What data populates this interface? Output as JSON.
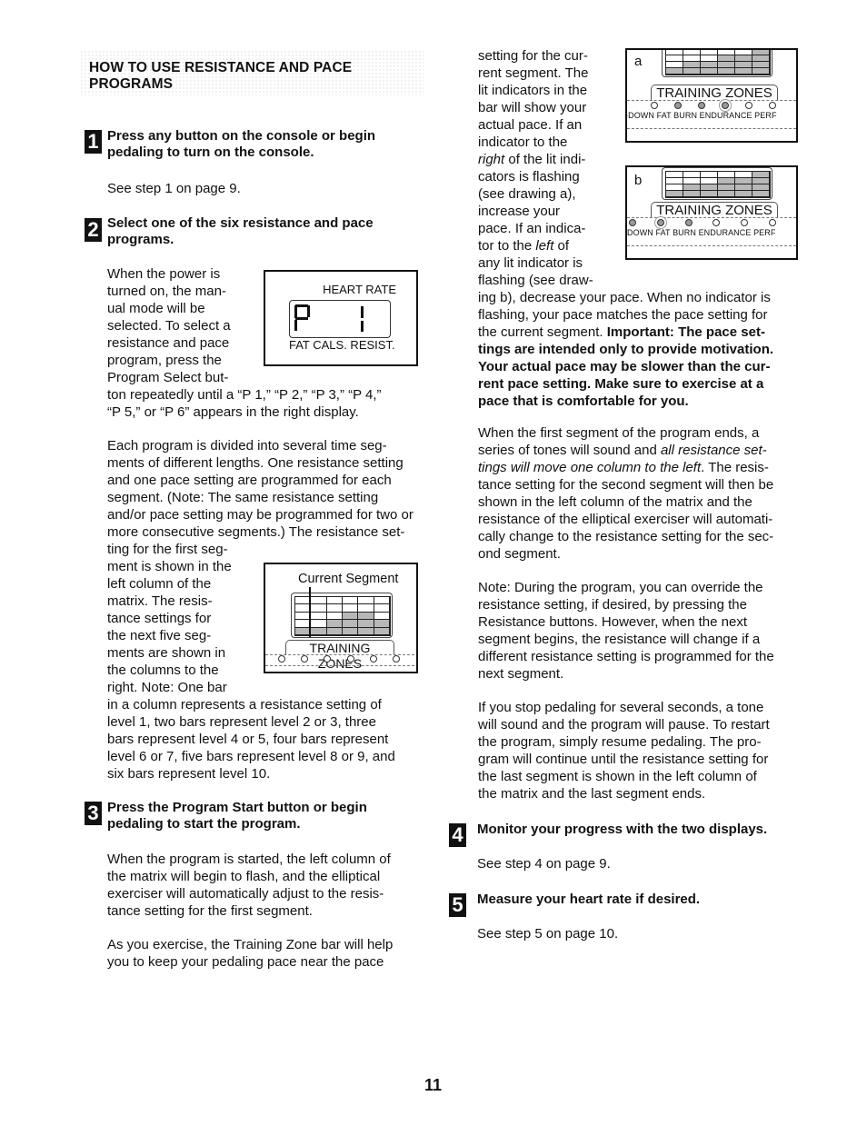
{
  "header": {
    "title_line1": "HOW TO USE RESISTANCE AND PACE",
    "title_line2": "PROGRAMS"
  },
  "steps": [
    {
      "number": "1",
      "heading_line1": "Press any button on the console or begin",
      "heading_line2": "pedaling to turn on the console.",
      "body": "See step 1 on page 9."
    },
    {
      "number": "2",
      "heading_line1": "Select one of the six resistance and pace",
      "heading_line2": "programs.",
      "wrap_lines": [
        "When the power is",
        "turned on, the man-",
        "ual mode will be",
        "selected. To select a",
        "resistance and pace",
        "program, press the",
        "Program Select but-"
      ],
      "full_lines": [
        "ton repeatedly until a “P 1,” “P 2,” “P 3,” “P 4,”",
        "“P 5,” or “P 6” appears in the right display."
      ],
      "para2_lines": [
        "Each program is divided into several time seg-",
        "ments of different lengths. One resistance setting",
        "and one pace setting are programmed for each",
        "segment. (Note: The same resistance setting",
        "and/or pace setting may be programmed for two or",
        "more consecutive segments.) The resistance set-"
      ],
      "para2_wrap_lines": [
        "ting for the first seg-",
        "ment is shown in the",
        "left column of the",
        "matrix. The resis-",
        "tance settings for",
        "the next five seg-",
        "ments are shown in",
        "the columns to the",
        "right. Note: One bar"
      ],
      "para2_full_lines": [
        "in a column represents a resistance setting of",
        "level 1, two bars represent level 2 or 3, three",
        "bars represent level 4 or 5, four bars represent",
        "level 6 or 7, five bars represent level 8 or 9, and",
        "six bars represent level 10."
      ]
    },
    {
      "number": "3",
      "heading_line1": "Press the Program Start button or begin",
      "heading_line2": "pedaling to start the program.",
      "para1_lines": [
        "When the program is started, the left column of",
        "the matrix will begin to flash, and the elliptical",
        "exerciser will automatically adjust to the resis-",
        "tance setting for the first segment."
      ],
      "para2_lines": [
        "As you exercise, the Training Zone bar will help",
        "you to keep your pedaling pace near the pace"
      ]
    },
    {
      "number": "4",
      "heading": "Monitor your progress with the two displays.",
      "body": "See step 4 on page 9."
    },
    {
      "number": "5",
      "heading": "Measure your heart rate if desired.",
      "body": "See step 5 on page 10."
    }
  ],
  "right_column": {
    "wrap_lines": [
      "setting for the cur-",
      "rent segment. The",
      "lit indicators in the",
      "bar will show your",
      "actual pace. If an",
      "indicator to the"
    ],
    "wrap_line_right_italic": "right",
    "wrap_line_right_rest": " of the lit indi-",
    "wrap_lines2": [
      "cators is flashing",
      "(see drawing a),",
      "increase your",
      "pace. If an indica-"
    ],
    "wrap_line_left_pre": "tor to the ",
    "wrap_line_left_italic": "left",
    "wrap_line_left_post": " of",
    "wrap_lines3": [
      "any lit indicator is",
      "flashing (see draw-"
    ],
    "full_lines": [
      "ing b), decrease your pace. When no indicator is",
      "flashing, your pace matches the pace setting for"
    ],
    "mixed_line_normal": "the current segment. ",
    "mixed_line_bold": "Important: The pace set-",
    "bold_lines": [
      "tings are intended only to provide motivation.",
      "Your actual pace may be slower than the cur-",
      "rent pace setting. Make sure to exercise at a",
      "pace that is comfortable for you."
    ],
    "para2_line1": "When the first segment of the program ends, a",
    "para2_line2_normal": "series of tones will sound and ",
    "para2_line2_italic": "all resistance set-",
    "para2_line3_italic": "tings will move one column to the left",
    "para2_line3_normal": ". The resis-",
    "para2_rest": [
      "tance setting for the second segment will then be",
      "shown in the left column of the matrix and the",
      "resistance of the elliptical exerciser will automati-",
      "cally change to the resistance setting for the sec-",
      "ond segment."
    ],
    "para3_lines": [
      "Note: During the program, you can override the",
      "resistance setting, if desired, by pressing the",
      "Resistance buttons. However, when the next",
      "segment begins, the resistance will change if a",
      "different resistance setting is programmed for the",
      "next segment."
    ],
    "para4_lines": [
      "If you stop pedaling for several seconds, a tone",
      "will sound and the program will pause. To restart",
      "the program, simply resume pedaling. The pro-",
      "gram will continue until the resistance setting for",
      "the last segment is shown in the left column of",
      "the matrix and the last segment ends."
    ]
  },
  "figures": {
    "display": {
      "top_label": "HEART RATE",
      "bottom_label": "FAT CALS. RESIST.",
      "readout": "P 1"
    },
    "matrix": {
      "label": "Current Segment",
      "zones_label": "TRAINING ZONES",
      "bars_per_column": [
        1,
        1,
        2,
        3,
        3,
        2
      ]
    },
    "drawing_a": {
      "letter": "a",
      "zones_label": "TRAINING ZONES",
      "zone_labels": "-DOWN   FAT BURN   ENDURANCE   PERF",
      "lit_indicators": [
        1,
        2
      ],
      "flashing_indicator": 3
    },
    "drawing_b": {
      "letter": "b",
      "zones_label": "TRAINING ZONES",
      "zone_labels": "DOWN   FAT BURN   ENDURANCE   PERF",
      "lit_indicators": [
        0,
        2
      ],
      "flashing_indicator": 1
    }
  },
  "footer": {
    "page_number": "11"
  }
}
